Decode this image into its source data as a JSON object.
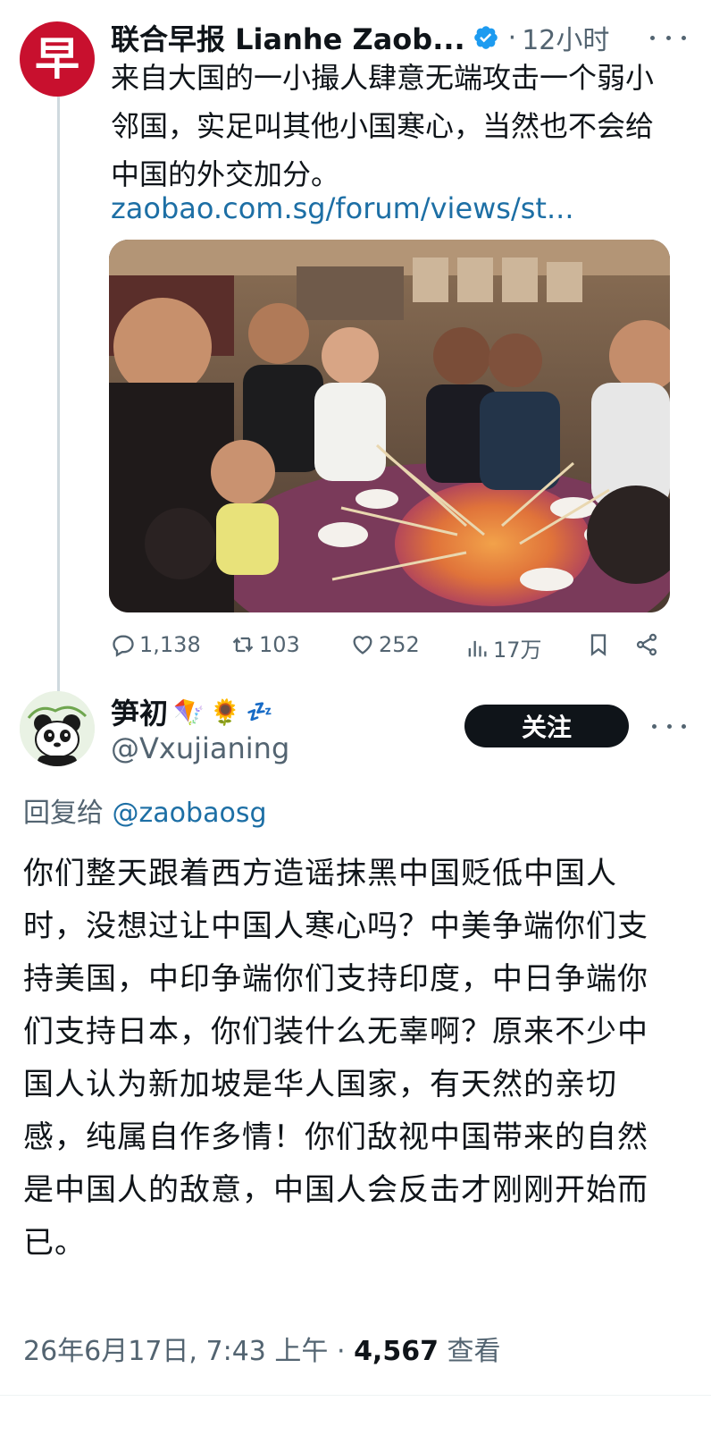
{
  "original_tweet": {
    "author_name": "联合早报 Lianhe Zaob...",
    "verified": true,
    "separator": "·",
    "time": "12小时",
    "text": "来自大国的一小撮人肆意无端攻击一个弱小邻国，实足叫其他小国寒心，当然也不会给中国的外交加分。",
    "link": "zaobao.com.sg/forum/views/st...",
    "avatar_char": "早",
    "actions": {
      "replies": "1,138",
      "retweets": "103",
      "likes": "252",
      "views": "17万"
    }
  },
  "reply_tweet": {
    "author_name": "笋初",
    "name_emojis": [
      "🪁",
      "🌻",
      "💤"
    ],
    "handle": "@Vxujianing",
    "follow_label": "关注",
    "reply_to_prefix": "回复给",
    "reply_to_handle": "@zaobaosg",
    "text": "你们整天跟着西方造谣抹黑中国贬低中国人时，没想过让中国人寒心吗？中美争端你们支持美国，中印争端你们支持印度，中日争端你们支持日本，你们装什么无辜啊？原来不少中国人认为新加坡是华人国家，有天然的亲切感，纯属自作多情！你们敌视中国带来的自然是中国人的敌意，中国人会反击才刚刚开始而已。",
    "timestamp": "26年6月17日, 7:43 上午",
    "meta_separator": "·",
    "view_count": "4,567",
    "view_label": "查看"
  },
  "colors": {
    "brand_red": "#c8102e",
    "verified_blue": "#1d9bf0",
    "link_blue": "#1d6fa5",
    "secondary_text": "#536471",
    "follow_button": "#0f1419"
  }
}
